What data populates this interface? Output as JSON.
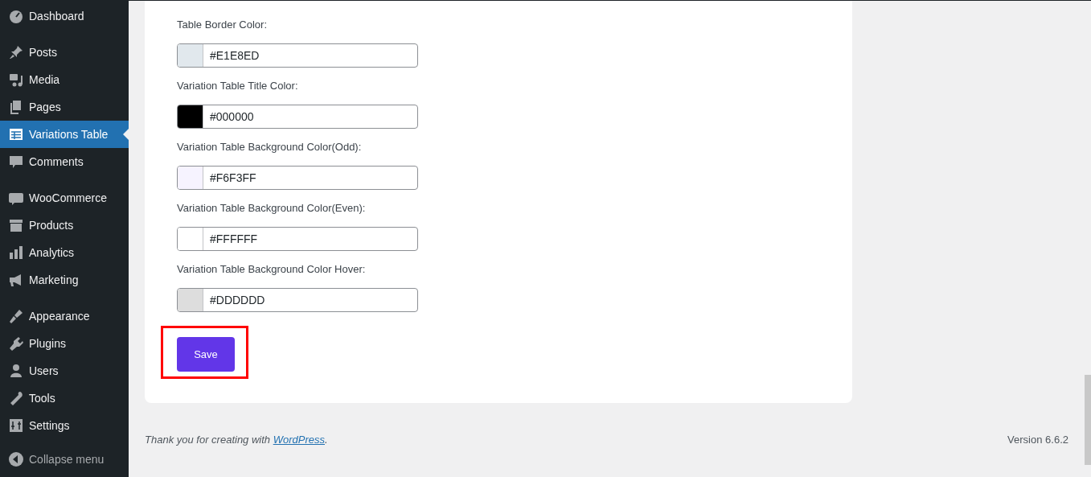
{
  "sidebar": {
    "groups": [
      [
        {
          "label": "Dashboard",
          "selected": false
        }
      ],
      [
        {
          "label": "Posts",
          "selected": false
        },
        {
          "label": "Media",
          "selected": false
        },
        {
          "label": "Pages",
          "selected": false
        },
        {
          "label": "Variations Table",
          "selected": true
        },
        {
          "label": "Comments",
          "selected": false
        }
      ],
      [
        {
          "label": "WooCommerce",
          "selected": false
        },
        {
          "label": "Products",
          "selected": false
        },
        {
          "label": "Analytics",
          "selected": false
        },
        {
          "label": "Marketing",
          "selected": false
        }
      ],
      [
        {
          "label": "Appearance",
          "selected": false
        },
        {
          "label": "Plugins",
          "selected": false
        },
        {
          "label": "Users",
          "selected": false
        },
        {
          "label": "Tools",
          "selected": false
        },
        {
          "label": "Settings",
          "selected": false
        }
      ]
    ],
    "collapse": "Collapse menu"
  },
  "settings": {
    "fields": [
      {
        "label": "Table Border Color:",
        "value": "#E1E8ED",
        "color": "#e1e8ed"
      },
      {
        "label": "Variation Table Title Color:",
        "value": "#000000",
        "color": "#000000"
      },
      {
        "label": "Variation Table Background Color(Odd):",
        "value": "#F6F3FF",
        "color": "#f6f3ff"
      },
      {
        "label": "Variation Table Background Color(Even):",
        "value": "#FFFFFF",
        "color": "#ffffff"
      },
      {
        "label": "Variation Table Background Color Hover:",
        "value": "#DDDDDD",
        "color": "#dddddd"
      }
    ],
    "save_button": "Save",
    "save_highlighted": true
  },
  "footer": {
    "thanks": "Thank you for creating with ",
    "link": "WordPress",
    "after_link": ".",
    "version": "Version 6.6.2"
  }
}
